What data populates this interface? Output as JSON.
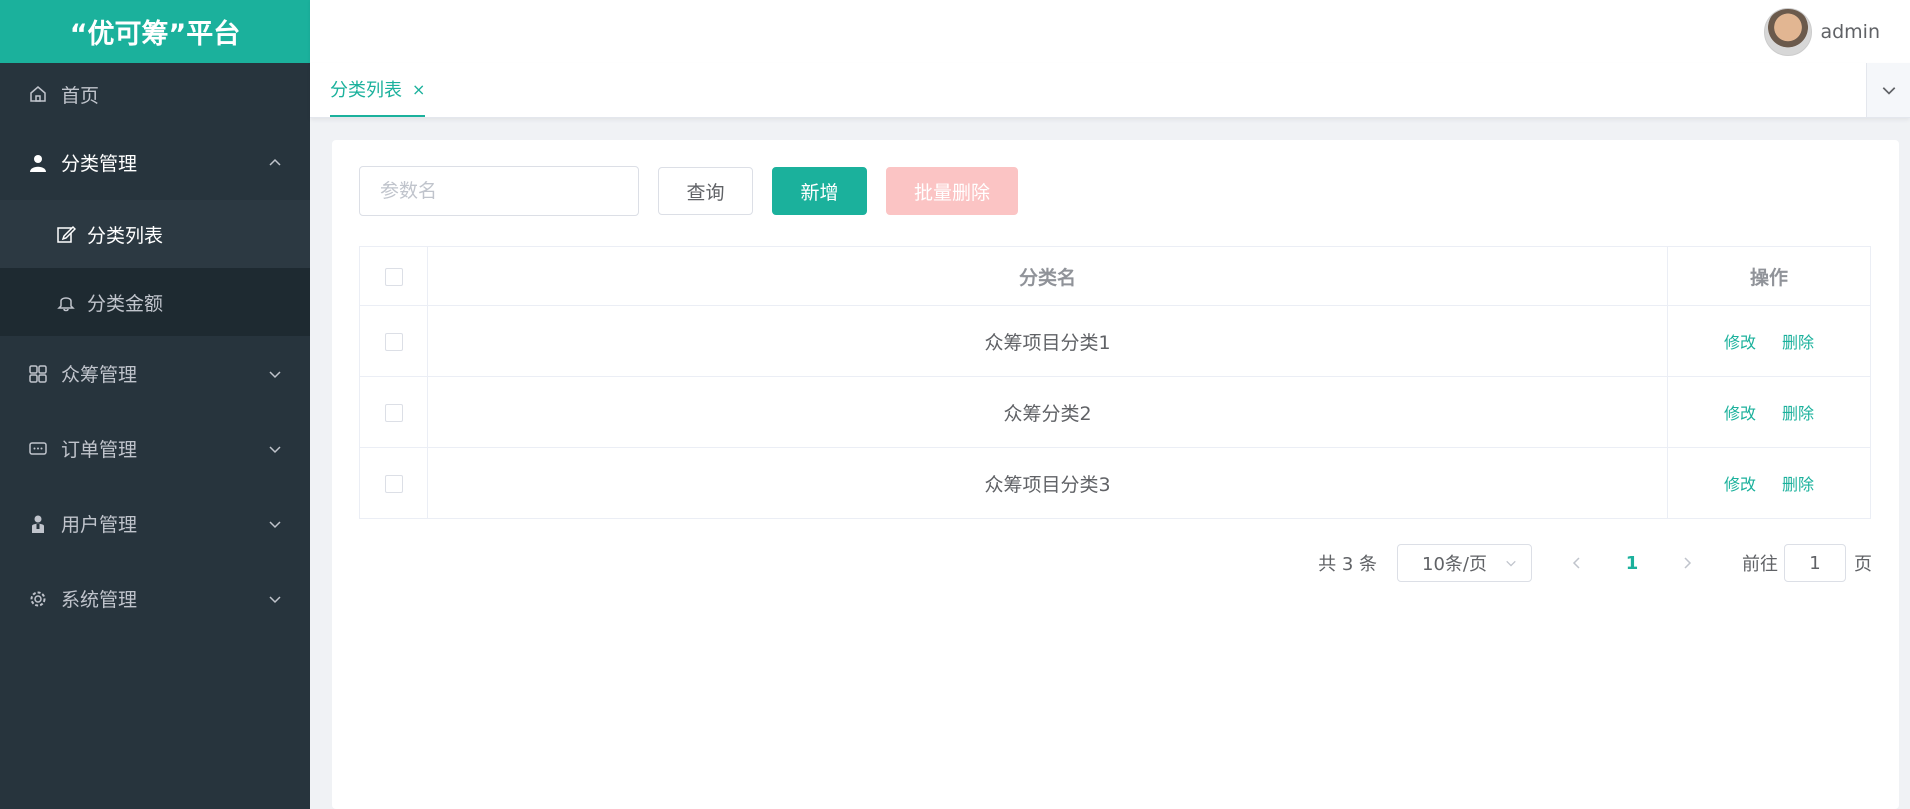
{
  "app": {
    "title": "“优可筹”平台"
  },
  "header": {
    "username": "admin"
  },
  "sidebar": {
    "items": [
      {
        "label": "首页",
        "icon": "home-icon"
      },
      {
        "label": "分类管理",
        "icon": "user-icon",
        "open": true,
        "children": [
          {
            "label": "分类列表",
            "icon": "edit-icon",
            "active": true
          },
          {
            "label": "分类金额",
            "icon": "bell-icon"
          }
        ]
      },
      {
        "label": "众筹管理",
        "icon": "grid-icon"
      },
      {
        "label": "订单管理",
        "icon": "chat-icon"
      },
      {
        "label": "用户管理",
        "icon": "person-icon"
      },
      {
        "label": "系统管理",
        "icon": "gear-icon"
      }
    ]
  },
  "tabs": [
    {
      "label": "分类列表",
      "close": "×"
    }
  ],
  "toolbar": {
    "search_placeholder": "参数名",
    "query_label": "查询",
    "add_label": "新增",
    "batch_delete_label": "批量删除"
  },
  "table": {
    "columns": [
      "分类名",
      "操作"
    ],
    "rows": [
      {
        "name": "众筹项目分类1",
        "edit": "修改",
        "delete": "删除"
      },
      {
        "name": "众筹分类2",
        "edit": "修改",
        "delete": "删除"
      },
      {
        "name": "众筹项目分类3",
        "edit": "修改",
        "delete": "删除"
      }
    ]
  },
  "pagination": {
    "total_text": "共 3 条",
    "page_size": "10条/页",
    "current_page": "1",
    "goto_prefix": "前往",
    "goto_value": "1",
    "goto_suffix": "页"
  },
  "colors": {
    "accent": "#1bb19c",
    "sidebar_bg": "#27343d",
    "danger_disabled": "#fbc4c4"
  }
}
